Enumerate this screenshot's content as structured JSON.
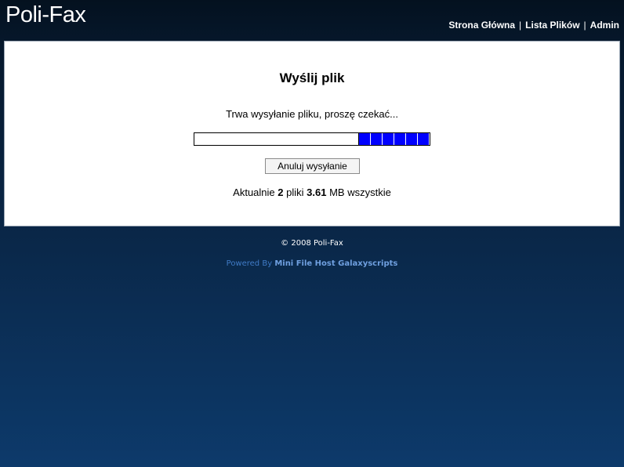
{
  "header": {
    "logo": "Poli-Fax",
    "nav": [
      {
        "label": "Strona Główna"
      },
      {
        "label": "Lista Plików"
      },
      {
        "label": "Admin"
      }
    ],
    "separator": "|"
  },
  "upload": {
    "title": "Wyślij plik",
    "status": "Trwa wysyłanie pliku, proszę czekać...",
    "progress_fraction": 0.3,
    "cancel_label": "Anuluj wysyłanie",
    "summary": {
      "prefix": "Aktualnie",
      "file_count": "2",
      "files_word": "pliki",
      "size": "3.61",
      "suffix": "MB wszystkie"
    }
  },
  "footer": {
    "copyright": "© 2008 Poli-Fax",
    "powered_prefix": "Powered By",
    "powered_link": "Mini File Host Galaxyscripts"
  },
  "colors": {
    "progress_fill": "#0000ff",
    "background_top": "#04111f",
    "background_bottom": "#0d3a6b"
  }
}
